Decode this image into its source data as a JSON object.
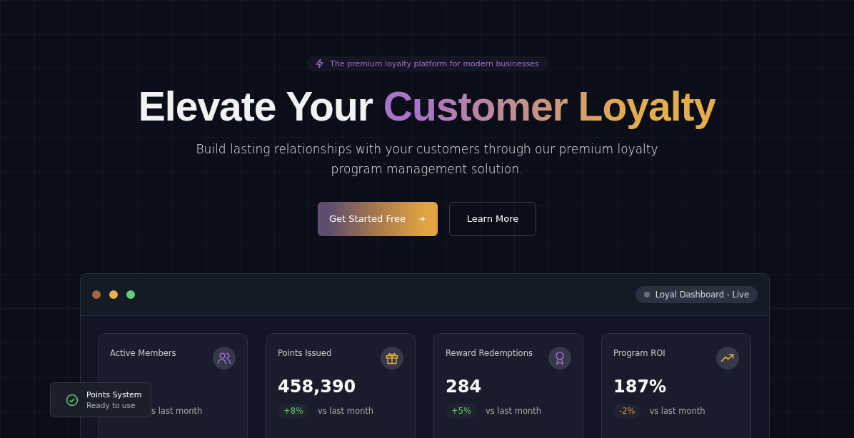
{
  "badge": {
    "text": "The premium loyalty platform for modern businesses"
  },
  "hero": {
    "title": "Elevate Your",
    "title_highlight": "Customer Loyalty",
    "subtitle": "Build lasting relationships with your customers through our premium loyalty program management solution."
  },
  "buttons": [
    {
      "label": "Get Started Free",
      "kind": "primary"
    },
    {
      "label": "Learn More",
      "kind": "secondary"
    }
  ],
  "dashboard": {
    "status": "Loyal Dashboard - Live",
    "stats": [
      {
        "title": "Active Members",
        "comparison": "s last month"
      },
      {
        "title": "Points Issued",
        "value": "458,390",
        "trend": "+8%",
        "color": "#5fc86d",
        "comparison": "vs last month"
      },
      {
        "title": "Reward Redemptions",
        "value": "284",
        "trend": "+5%",
        "color": "#5fc86d",
        "comparison": "vs last month"
      },
      {
        "title": "Program ROI",
        "value": "187%",
        "trend": "-2%",
        "color": "#d48a3c",
        "comparison": "vs last month"
      }
    ]
  },
  "toast": {
    "title": "Points System",
    "subtitle": "Ready to use"
  }
}
